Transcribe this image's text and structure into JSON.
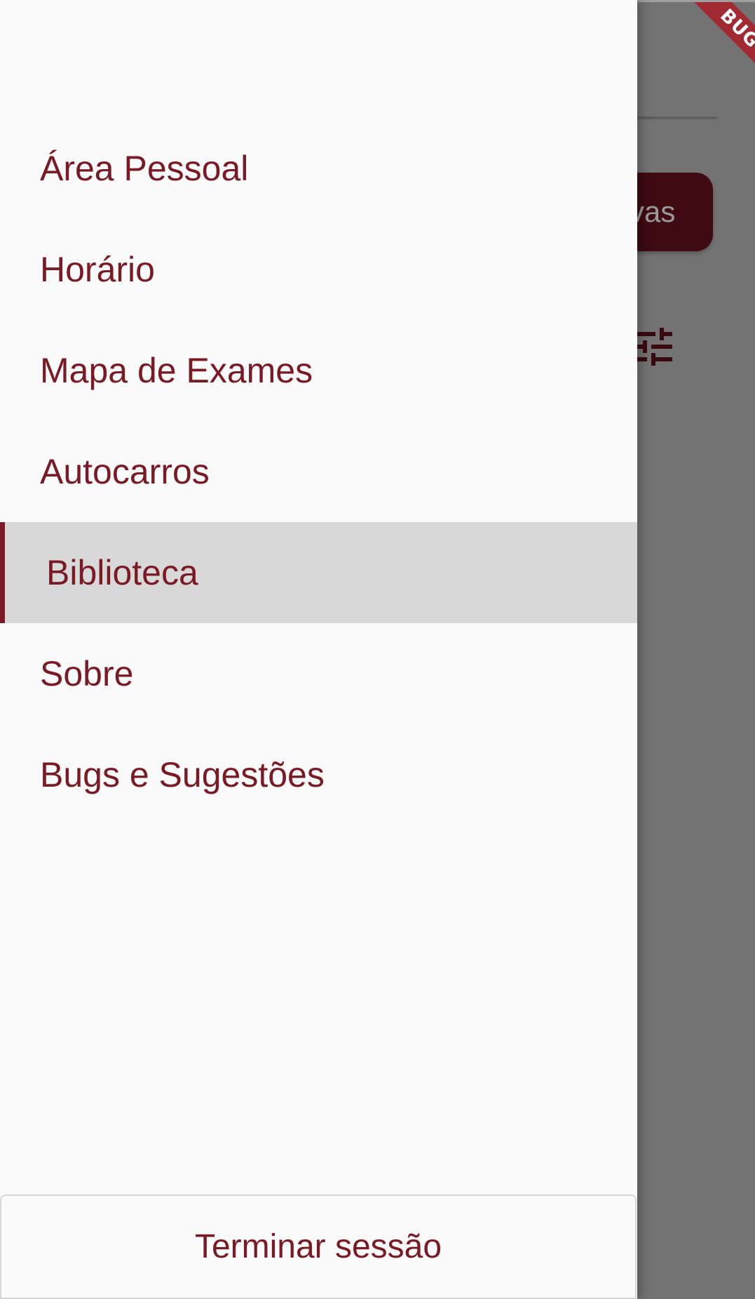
{
  "background": {
    "button_text": "rvas",
    "debug_banner": "BUG"
  },
  "drawer": {
    "items": [
      {
        "label": "Área Pessoal",
        "active": false
      },
      {
        "label": "Horário",
        "active": false
      },
      {
        "label": "Mapa de Exames",
        "active": false
      },
      {
        "label": "Autocarros",
        "active": false
      },
      {
        "label": "Biblioteca",
        "active": true
      },
      {
        "label": "Sobre",
        "active": false
      },
      {
        "label": "Bugs e Sugestões",
        "active": false
      }
    ],
    "logout_label": "Terminar sessão"
  },
  "colors": {
    "accent": "#7a1a24",
    "drawer_background": "#fafafa",
    "active_item_background": "#d8d8d8",
    "scrim": "#737373"
  },
  "icons": {
    "filter": "tune-icon"
  }
}
